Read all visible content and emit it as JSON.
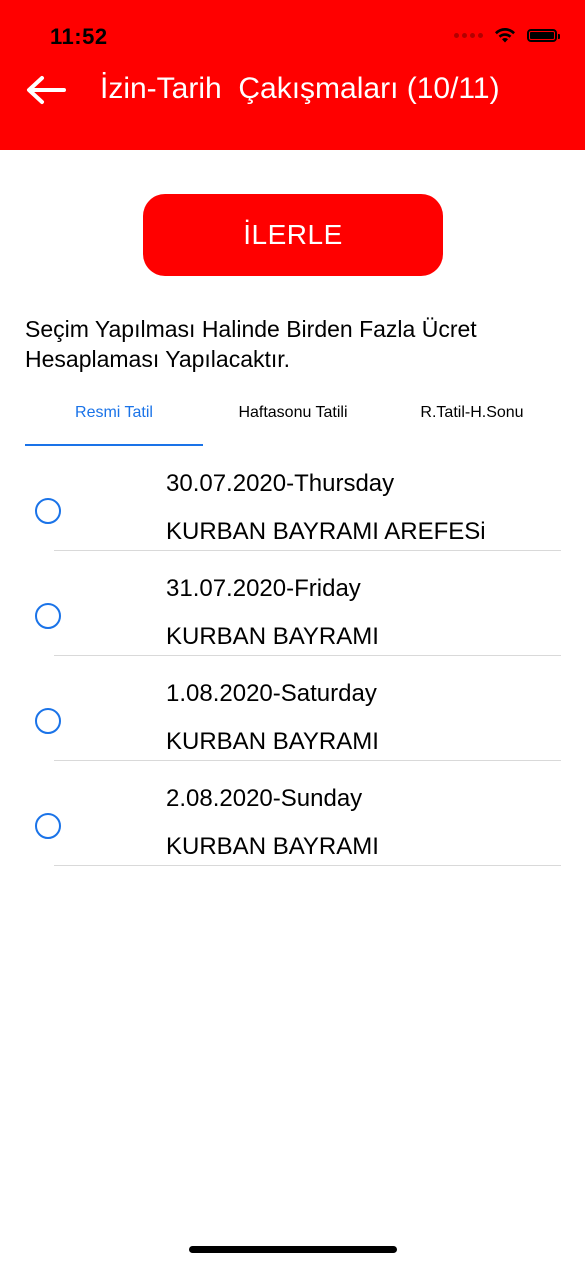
{
  "status_bar": {
    "time": "11:52"
  },
  "header": {
    "title": "İzin-Tarih  Çakışmaları (10/11)",
    "back_icon": "arrow-left-icon",
    "background_color": "#ff0000"
  },
  "actions": {
    "continue_label": "İLERLE"
  },
  "info": {
    "text": "Seçim Yapılması Halinde Birden Fazla Ücret Hesaplaması Yapılacaktır."
  },
  "tabs": [
    {
      "label": "Resmi Tatil",
      "active": true
    },
    {
      "label": "Haftasonu Tatili",
      "active": false
    },
    {
      "label": "R.Tatil-H.Sonu",
      "active": false
    }
  ],
  "items": [
    {
      "date": "30.07.2020-Thursday",
      "name": "KURBAN BAYRAMI AREFESi",
      "selected": false
    },
    {
      "date": "31.07.2020-Friday",
      "name": "KURBAN BAYRAMI",
      "selected": false
    },
    {
      "date": "1.08.2020-Saturday",
      "name": "KURBAN BAYRAMI",
      "selected": false
    },
    {
      "date": "2.08.2020-Sunday",
      "name": "KURBAN BAYRAMI",
      "selected": false
    }
  ],
  "colors": {
    "accent": "#1a73e8",
    "brand": "#ff0000"
  }
}
